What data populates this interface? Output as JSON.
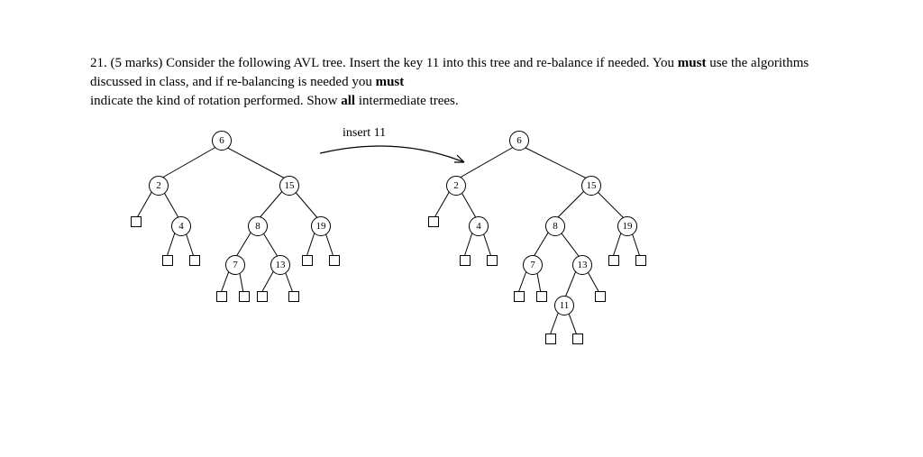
{
  "question": {
    "number": "21.",
    "marks": "(5 marks)",
    "text_part1": "Consider the following AVL tree.  Insert the key 11 into this tree and re-balance if needed.  You ",
    "must1": "must",
    "text_part2": " use the algorithms discussed in class, and if re-balancing is needed you ",
    "must2": "must",
    "text_part3": " indicate the kind of rotation performed.  Show ",
    "all": "all",
    "text_part4": " intermediate trees."
  },
  "insert_label": "insert 11",
  "trees": {
    "left": {
      "nodes": {
        "n6": "6",
        "n2": "2",
        "n15": "15",
        "n4": "4",
        "n8": "8",
        "n19": "19",
        "n7": "7",
        "n13": "13"
      }
    },
    "right": {
      "nodes": {
        "n6": "6",
        "n2": "2",
        "n15": "15",
        "n4": "4",
        "n8": "8",
        "n19": "19",
        "n7": "7",
        "n13": "13",
        "n11": "11"
      }
    }
  }
}
